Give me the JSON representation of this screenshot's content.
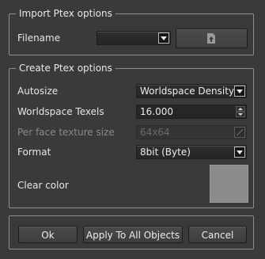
{
  "import_group": {
    "title": "Import Ptex options",
    "filename_label": "Filename",
    "filename_value": "",
    "upload_icon": "upload-file-icon"
  },
  "create_group": {
    "title": "Create Ptex options",
    "autosize_label": "Autosize",
    "autosize_value": "Worldspace Density",
    "texels_label": "Worldspace Texels",
    "texels_value": "16.000",
    "face_size_label": "Per face texture size",
    "face_size_value": "64x64",
    "format_label": "Format",
    "format_value": "8bit (Byte)",
    "clear_color_label": "Clear color",
    "clear_color_hex": "#8a8a8a"
  },
  "buttons": {
    "ok": "Ok",
    "apply_all": "Apply To All Objects",
    "cancel": "Cancel"
  }
}
